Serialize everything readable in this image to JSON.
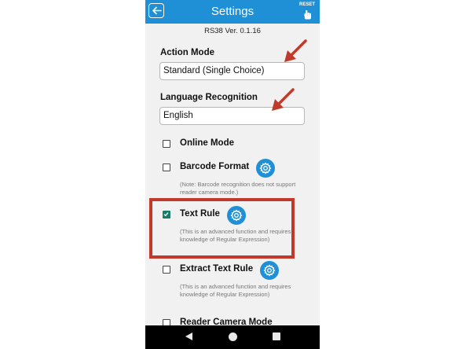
{
  "header": {
    "title": "Settings",
    "reset_label": "RESET"
  },
  "version": "RS38 Ver. 0.1.16",
  "action_mode": {
    "label": "Action Mode",
    "value": "Standard (Single Choice)"
  },
  "language": {
    "label": "Language Recognition",
    "value": "English"
  },
  "options": [
    {
      "label": "Online Mode",
      "checked": false,
      "has_settings": false,
      "note": ""
    },
    {
      "label": "Barcode Format",
      "checked": false,
      "has_settings": true,
      "note": "(Note: Barcode recognition does not support reader camera mode.)"
    },
    {
      "label": "Text Rule",
      "checked": true,
      "has_settings": true,
      "note": "(This is an advanced function and requires knowledge of Regular Expression)"
    },
    {
      "label": "Extract Text Rule",
      "checked": false,
      "has_settings": true,
      "note": "(This is an advanced function and requires knowledge of Regular Expression)"
    },
    {
      "label": "Reader Camera Mode",
      "checked": false,
      "has_settings": false,
      "note": ""
    }
  ],
  "icons": {
    "back": "back-arrow-icon",
    "reset": "tap-hand-icon",
    "settings": "gear-icon"
  },
  "colors": {
    "accent": "#1f8fd6",
    "checked": "#1d7a6a",
    "annotation": "#c0392b"
  }
}
